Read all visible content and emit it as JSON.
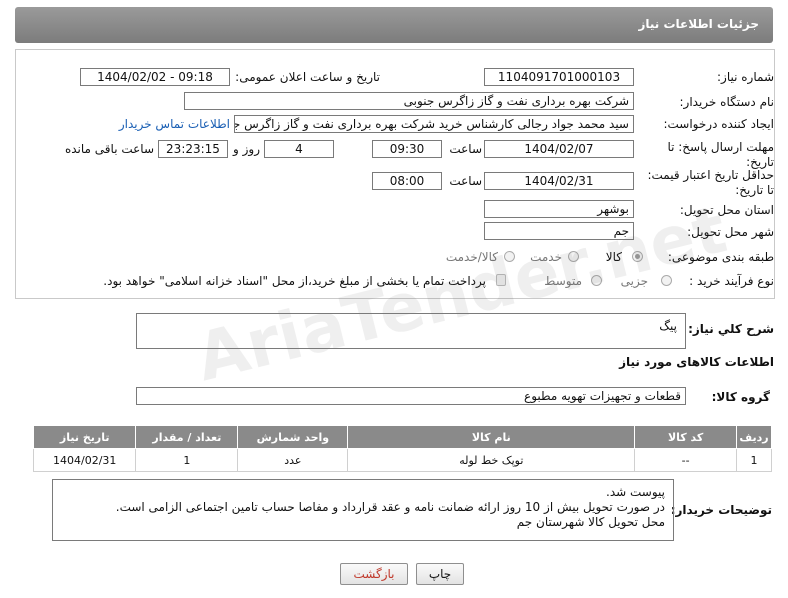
{
  "header": {
    "title": "جزئیات اطلاعات نیاز"
  },
  "form": {
    "need_number_label": "شماره نیاز:",
    "need_number": "1104091701000103",
    "announce_label": "تاریخ و ساعت اعلان عمومی:",
    "announce_value": "1404/02/02 - 09:18",
    "buyer_org_label": "نام دستگاه خریدار:",
    "buyer_org": "شرکت بهره برداری نفت و گاز زاگرس جنوبی",
    "requester_label": "ایجاد کننده درخواست:",
    "requester": "سید محمد جواد رجالی کارشناس خرید شرکت بهره برداری نفت و گاز زاگرس جنوبی",
    "contact_link": "اطلاعات تماس خریدار",
    "deadline_label": "مهلت ارسال پاسخ: تا تاریخ:",
    "deadline_date": "1404/02/07",
    "time_label": "ساعت",
    "deadline_time": "09:30",
    "days_value": "4",
    "days_label": "روز و",
    "remaining_time": "23:23:15",
    "remaining_label": "ساعت باقی مانده",
    "min_price_label": "حداقل تاریخ اعتبار قیمت: تا تاریخ:",
    "min_price_date": "1404/02/31",
    "min_price_time": "08:00",
    "province_label": "استان محل تحویل:",
    "province": "بوشهر",
    "city_label": "شهر محل تحویل:",
    "city": "جم",
    "category_label": "طبقه بندی موضوعی:",
    "category_options": [
      "کالا",
      "خدمت",
      "کالا/خدمت"
    ],
    "category_selected": "کالا",
    "process_label": "نوع فرآیند خرید :",
    "process_options": [
      "جزیی",
      "متوسط"
    ],
    "process_note": "پرداخت تمام یا بخشی از مبلغ خرید،از محل \"اسناد خزانه اسلامی\" خواهد بود."
  },
  "summary": {
    "label": "شرح کلي نياز:",
    "value": "پیگ"
  },
  "goods": {
    "section_title": "اطلاعات کالاهای مورد نیاز",
    "group_label": "گروه کالا:",
    "group_value": "قطعات و تجهیزات تهویه مطبوع",
    "columns": [
      "ردیف",
      "کد کالا",
      "نام کالا",
      "واحد شمارش",
      "تعداد / مقدار",
      "تاریخ نیاز"
    ],
    "rows": [
      [
        "1",
        "--",
        "توپک خط لوله",
        "عدد",
        "1",
        "1404/02/31"
      ]
    ]
  },
  "notes": {
    "label": "توضیحات خریدار:",
    "lines": [
      "پیوست شد.",
      "در صورت تحویل بیش از 10 روز ارائه ضمانت نامه و عقد قرارداد  و مفاصا حساب تامین اجتماعی الزامی است.",
      "محل تحویل کالا شهرستان جم"
    ]
  },
  "buttons": {
    "print": "چاپ",
    "back": "بازگشت"
  },
  "watermark": "AriaTender.net",
  "colors": {
    "title_bar": "#8a8a8a",
    "link": "#1a5fb4",
    "back_button_text": "#c0392b"
  }
}
